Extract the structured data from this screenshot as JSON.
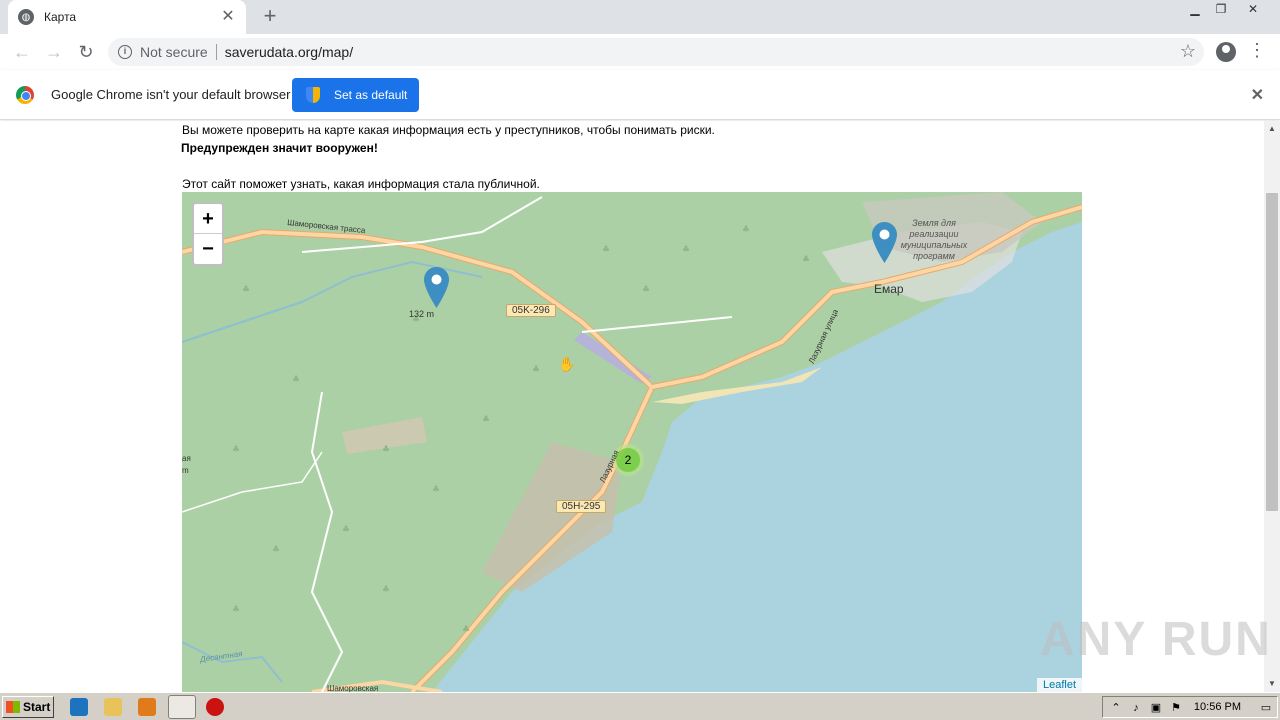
{
  "browser": {
    "tab_title": "Карта",
    "tab_icon": "globe-icon",
    "new_tab": "+",
    "tab_close": "✕",
    "security_label": "Not secure",
    "url": "saverudata.org/map/"
  },
  "infobar": {
    "message": "Google Chrome isn't your default browser",
    "button_label": "Set as default"
  },
  "page": {
    "line1": "Вы можете проверить на карте какая информация есть у преступников, чтобы понимать риски.",
    "line2": "Предупрежден значит вооружен!",
    "line3": "Этот сайт поможет узнать, какая информация стала публичной."
  },
  "map": {
    "zoom_in": "+",
    "zoom_out": "−",
    "attribution": "Leaflet",
    "cluster_count": "2",
    "road_labels": [
      "05K-296",
      "05H-295"
    ],
    "place_labels": {
      "town": "Емар",
      "land_note": "Земля для реализации муниципальных программ",
      "elevation": "132 m",
      "road_top": "Шаморовская трасса",
      "road_bottom": "Шаморовская",
      "street": "Лазурная улица",
      "street_south": "Лазурная",
      "stream": "Десантная",
      "edge_fragment": "ая",
      "edge_fragment_2": "m"
    },
    "colors": {
      "land": "#acd0a5",
      "water": "#aad3df",
      "road": "#fcd6a4",
      "cluster": "#6ecc39",
      "marker": "#3e8ec1"
    }
  },
  "watermark": "ANY RUN",
  "taskbar": {
    "start_label": "Start",
    "clock": "10:56 PM"
  }
}
